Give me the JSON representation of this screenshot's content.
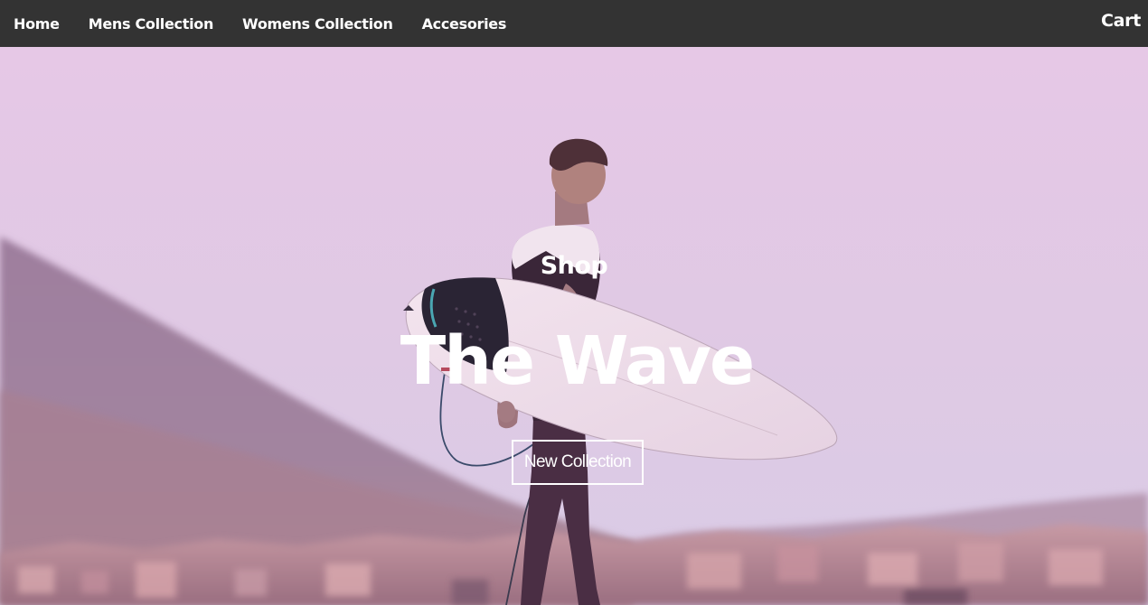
{
  "nav": {
    "items": [
      {
        "label": "Home"
      },
      {
        "label": "Mens Collection"
      },
      {
        "label": "Womens Collection"
      },
      {
        "label": "Accesories"
      }
    ],
    "cart_label": "Cart"
  },
  "hero": {
    "subtitle": "Shop",
    "title": "The Wave",
    "cta_label": "New Collection",
    "image_subject": "surfer carrying a surfboard at the coast",
    "tint_color": "#e3c9e6"
  },
  "colors": {
    "navbar_bg": "#333333",
    "nav_text": "#ffffff",
    "hero_text": "#ffffff"
  }
}
